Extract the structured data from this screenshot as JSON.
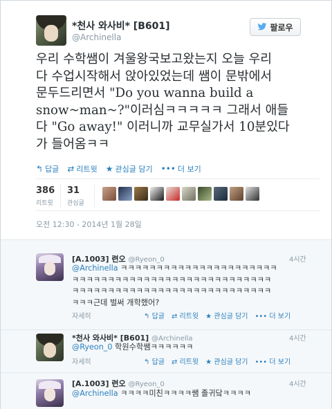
{
  "tweet": {
    "author_name": "*천사 와사비* [B601]",
    "author_handle": "@Archinella",
    "follow_label": "팔로우",
    "text_lines": [
      "우리 수학쌤이 겨울왕국보고왔는지 오늘 우리",
      "다 수업시작해서 앉아있었는데 쌤이 문밖에서",
      "문두드리면서 \"Do you wanna build a",
      "snow~man~?\"이러심ㅋㅋㅋㅋㅋ 그래서 애들",
      "다 \"Go away!\" 이러니까 교무실가서 10분있다",
      "가 들어옴ㅋㅋ"
    ],
    "actions": {
      "reply": "답글",
      "retweet": "리트윗",
      "favorite": "관심글 담기",
      "more": "더 보기"
    },
    "stats": {
      "retweets_count": "386",
      "retweets_label": "리트윗",
      "favorites_count": "31",
      "favorites_label": "관심글"
    },
    "timestamp": "오전 12:30 - 2014년 1월 28일"
  },
  "replies": [
    {
      "name": "[A.1003] 련오",
      "handle": "@Ryeon_0",
      "time": "4시간",
      "mention": "@Archinella",
      "lines": [
        " ㅋㅋㅋㅋㅋㅋㅋㅋㅋㅋㅋㅋㅋㅋㅋㅋㅋㅋㅋㅋㅋㅋ",
        "ㅋㅋㅋㅋㅋㅋㅋㅋㅋㅋㅋㅋㅋㅋㅋㅋㅋㅋㅋㅋㅋㅋㅋㅋㅋㅋㅋㅋ",
        "ㅋㅋㅋㅋㅋㅋㅋㅋㅋㅋㅋㅋㅋㅋㅋㅋㅋㅋㅋㅋㅋㅋㅋㅋㅋㅋㅋㅋ",
        "ㅋㅋㅋ근데 벌써 개학했어?"
      ],
      "detail": "자세히",
      "reply": "답글",
      "retweet": "리트윗",
      "favorite": "관심글 담기",
      "more": "더 보기"
    },
    {
      "name": "*천사 와사비* [B601]",
      "handle": "@Archinella",
      "time": "4시간",
      "mention": "@Ryeon_0",
      "lines": [
        " 학원수학쌤ㅋㅋㅋㅋㅋㅋ"
      ],
      "detail": "자세히",
      "reply": "답글",
      "retweet": "리트윗",
      "favorite": "관심글 담기",
      "more": "더 보기"
    },
    {
      "name": "[A.1003] 련오",
      "handle": "@Ryeon_0",
      "time": "4시간",
      "mention": "@Archinella",
      "lines": [
        " ㅋㅋㅋㅋ미친ㅋㅋㅋㅋ쌤 졸귀닼ㅋㅋㅋㅋ"
      ]
    }
  ],
  "icons": {
    "reply": "reply-arrow-icon",
    "retweet": "retweet-icon",
    "favorite": "star-icon",
    "more": "ellipsis-icon",
    "follow": "twitter-bird-icon"
  },
  "colors": {
    "link": "#2a7fbd",
    "muted": "#8899a6",
    "follow_bird": "#55acee"
  }
}
